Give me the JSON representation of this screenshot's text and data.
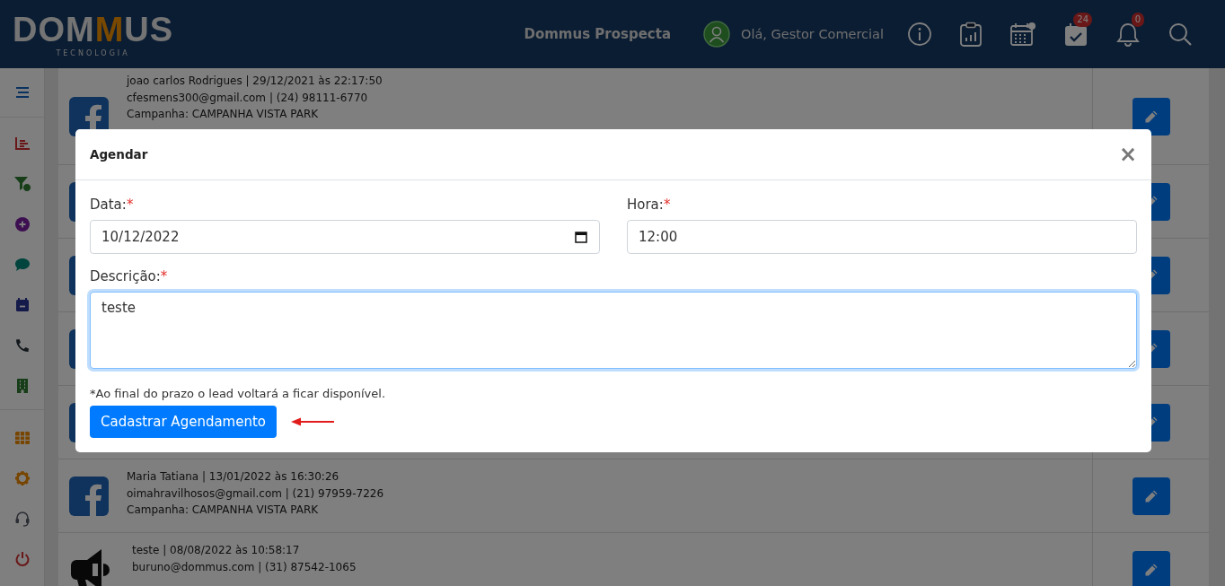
{
  "header": {
    "logo": {
      "start": "DOM",
      "accent": "M",
      "end": "US",
      "tagline": "TECNOLOGIA"
    },
    "app_name": "Dommus Prospecta",
    "greeting": "Olá, Gestor Comercial",
    "icons": [
      {
        "kind": "info"
      },
      {
        "kind": "report"
      },
      {
        "kind": "calendar"
      },
      {
        "kind": "tasks",
        "badge": "24"
      },
      {
        "kind": "bell",
        "badge": "0"
      },
      {
        "kind": "search"
      }
    ]
  },
  "sidebar": {
    "sections": [
      [
        {
          "kind": "menu"
        }
      ],
      [
        {
          "kind": "chart"
        },
        {
          "kind": "funnel"
        },
        {
          "kind": "add"
        },
        {
          "kind": "chat"
        },
        {
          "kind": "calendar"
        },
        {
          "kind": "phone"
        },
        {
          "kind": "building"
        }
      ],
      [
        {
          "kind": "grid"
        },
        {
          "kind": "settings"
        },
        {
          "kind": "support"
        },
        {
          "kind": "power"
        }
      ]
    ]
  },
  "leads": [
    {
      "kind": "facebook",
      "lines": [
        "joao carlos Rodrigues | 29/12/2021 às 22:17:50",
        "cfesmens300@gmail.com | (24) 98111-6770",
        "Campanha: CAMPANHA VISTA PARK"
      ]
    },
    {
      "kind": "facebook"
    },
    {
      "kind": "facebook"
    },
    {
      "kind": "facebook"
    },
    {
      "kind": "facebook"
    },
    {
      "kind": "facebook",
      "lines": [
        "Maria Tatiana | 13/01/2022 às 16:30:26",
        "oimahravilhosos@gmail.com | (21) 97959-7226",
        "Campanha: CAMPANHA VISTA PARK"
      ]
    },
    {
      "kind": "megaphone",
      "lines": [
        "teste | 08/08/2022 às 10:58:17",
        "buruno@dommus.com | (31) 87542-1065"
      ]
    }
  ],
  "modal": {
    "title": "Agendar",
    "close": "×",
    "fields": [
      {
        "kind": "date",
        "label": "Data:",
        "required_mark": "*",
        "value": "10/12/2022"
      },
      {
        "kind": "time",
        "label": "Hora:",
        "required_mark": "*",
        "value": "12:00"
      }
    ],
    "description": {
      "label": "Descrição:",
      "required_mark": "*",
      "value": "teste",
      "focused": true
    },
    "note": "*Ao final do prazo o lead voltará a ficar disponível.",
    "submit": "Cadastrar Agendamento"
  }
}
